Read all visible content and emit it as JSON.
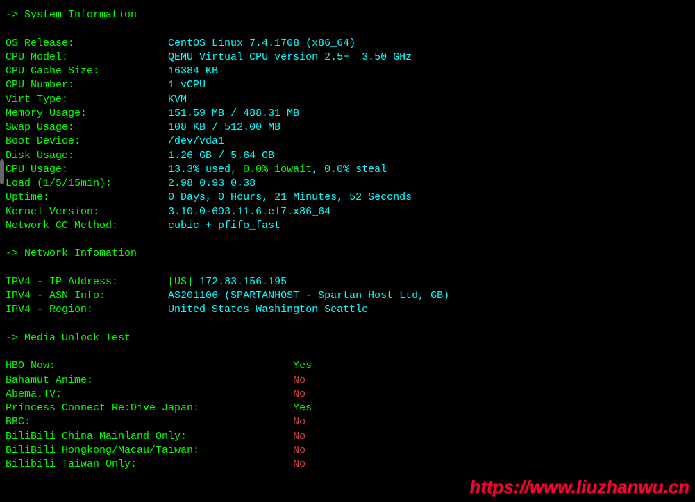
{
  "headers": {
    "system": "-> System Information",
    "network": "-> Network Infomation",
    "media": "-> Media Unlock Test"
  },
  "sys": {
    "os_release_label": "OS Release:",
    "os_release_value": "CentOS Linux 7.4.1708 (x86_64)",
    "cpu_model_label": "CPU Model:",
    "cpu_model_value": "QEMU Virtual CPU version 2.5+  3.50 GHz",
    "cpu_cache_label": "CPU Cache Size:",
    "cpu_cache_value": "16384 KB",
    "cpu_number_label": "CPU Number:",
    "cpu_number_value": "1 vCPU",
    "virt_type_label": "Virt Type:",
    "virt_type_value": "KVM",
    "memory_label": "Memory Usage:",
    "memory_used": "151.59 MB",
    "memory_total": "488.31 MB",
    "swap_label": "Swap Usage:",
    "swap_used": "108 KB",
    "swap_total": "512.00 MB",
    "boot_label": "Boot Device:",
    "boot_value": "/dev/vda1",
    "disk_label": "Disk Usage:",
    "disk_used": "1.26 GB",
    "disk_total": "5.64 GB",
    "cpu_usage_label": "CPU Usage:",
    "cpu_used_txt": "13.3% used",
    "cpu_iowait_txt": "0.0% iowait",
    "cpu_steal_txt": "0.0% steal",
    "load_label": "Load (1/5/15min):",
    "load_1": "2.98 ",
    "load_5": "0.93 ",
    "load_15": "0.38",
    "uptime_label": "Uptime:",
    "uptime_value": "0 Days, 0 Hours, 21 Minutes, 52 Seconds",
    "kernel_label": "Kernel Version:",
    "kernel_value": "3.10.0-693.11.6.el7.x86_64",
    "cc_label": "Network CC Method:",
    "cc_value": "cubic + pfifo_fast",
    "sep": " / ",
    "comma": ", "
  },
  "net": {
    "ip_label": "IPV4 - IP Address:",
    "ip_country": "[US] ",
    "ip_value": "172.83.156.195",
    "asn_label": "IPV4 - ASN Info:",
    "asn_value": "AS201106 (SPARTANHOST - Spartan Host Ltd, GB)",
    "region_label": "IPV4 - Region:",
    "region_value": "United States Washington Seattle"
  },
  "media": [
    {
      "label": "HBO Now:",
      "result": "Yes",
      "ok": true
    },
    {
      "label": "Bahamut Anime:",
      "result": "No",
      "ok": false
    },
    {
      "label": "Abema.TV:",
      "result": "No",
      "ok": false
    },
    {
      "label": "Princess Connect Re:Dive Japan:",
      "result": "Yes",
      "ok": true
    },
    {
      "label": "BBC:",
      "result": "No",
      "ok": false
    },
    {
      "label": "BiliBili China Mainland Only:",
      "result": "No",
      "ok": false
    },
    {
      "label": "BiliBili Hongkong/Macau/Taiwan:",
      "result": "No",
      "ok": false
    },
    {
      "label": "Bilibili Taiwan Only:",
      "result": "No",
      "ok": false
    }
  ],
  "watermark": "https://www.liuzhanwu.cn"
}
